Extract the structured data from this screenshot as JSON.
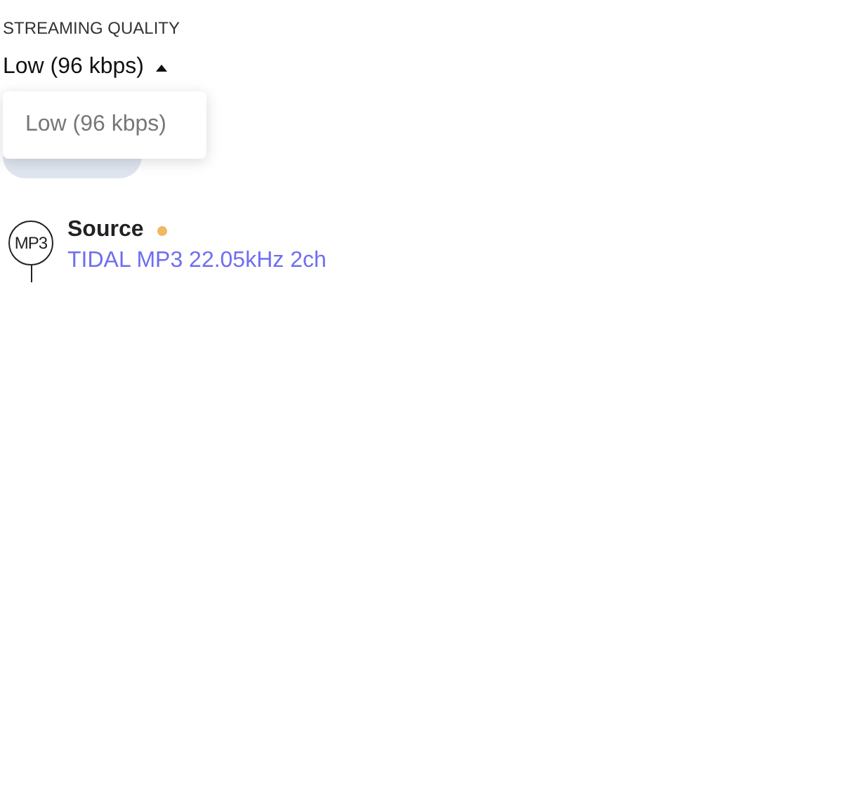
{
  "streaming_quality": {
    "label": "STREAMING QUALITY",
    "value": "Low (96 kbps)",
    "expanded": true,
    "options": [
      {
        "label": "Low (96 kbps)",
        "selected": true
      }
    ]
  },
  "source": {
    "badge": "MP3",
    "title": "Source",
    "color": "#f0b860",
    "detail": "TIDAL MP3 22.05kHz 2ch"
  }
}
